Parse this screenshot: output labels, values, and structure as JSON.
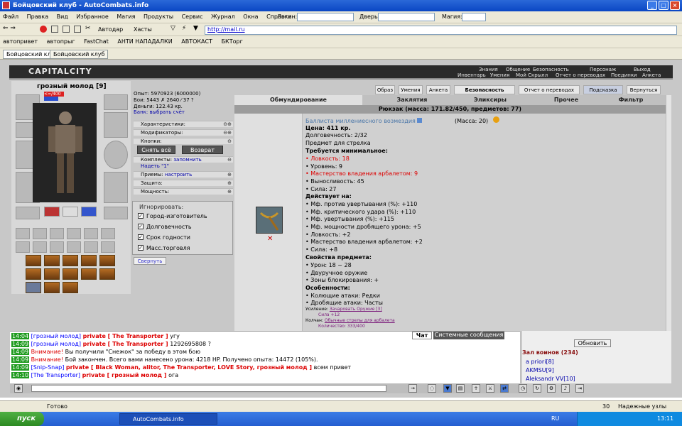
{
  "window": {
    "title": "Бойцовский клуб - AutoCombats.info",
    "buttons": [
      "_",
      "□",
      "×"
    ]
  },
  "menu": {
    "items": [
      "Файл",
      "Правка",
      "Вид",
      "Избранное",
      "Магия",
      "Продукты",
      "Сервис",
      "Журнал",
      "Окна",
      "Справка"
    ],
    "login_label": "Логин:",
    "door_label": "Дверь:",
    "magic_label": "Магия:"
  },
  "address": {
    "dropdown1": "Автодар",
    "dropdown2": "Хасты",
    "url": "http://mail.ru"
  },
  "links": [
    "автопривет",
    "автопрыг",
    "FastChat",
    "АНТИ НАПАДАЛКИ",
    "АВТОКАСТ",
    "БКТорг"
  ],
  "browser_tabs": [
    "Бойцовский клуб",
    "Бойцовский клуб"
  ],
  "game_header": {
    "logo": "CAPITALCITY",
    "top_links": [
      "Знания",
      "Общение",
      "Безопасность",
      "Персонаж",
      "Выход"
    ],
    "bottom_links": [
      "Инвентарь",
      "Умения",
      "Мой Скрылл",
      "Отчет о переводах",
      "Поединки",
      "Анкета"
    ]
  },
  "character": {
    "name": "грозный молод",
    "level": "[9]",
    "hp": "<=/400",
    "stats": {
      "exp": "Опыт: 5970923 (6000000)",
      "wins": "Бои: 5443 ✗ 2640 ⁄ 37 ?",
      "money": "Деньги: 122.43 кр.",
      "bank": "Банк: выбрать счёт"
    },
    "sections": [
      "Характеристики:",
      "Модификаторы:",
      "Кнопки:"
    ],
    "undress": "Снять всё",
    "back": "Возврат",
    "sets": [
      "Комплекты:",
      "Приемы:",
      "Защита:",
      "Мощность:"
    ],
    "sets_link": "запомнить",
    "equip": "Надеть \"1\"",
    "tricks_link": "настроить",
    "ignore_title": "Игнорировать:",
    "ignore": [
      "Город-изготовитель",
      "Долговечность",
      "Срок годности",
      "Масс.торговля"
    ],
    "collapse": "Свернуть"
  },
  "store": {
    "top_buttons": [
      "Образ",
      "Умения",
      "Анкета",
      "Безопасность",
      "Отчет о переводах",
      "Подсказка",
      "Вернуться"
    ],
    "tabs": [
      "Обмундирование",
      "Заклятия",
      "Эликсиры",
      "Прочее",
      "Фильтр"
    ],
    "backpack": "Рюкзак (масса: 171.82/450, предметов: 77)",
    "item": {
      "name": "Баллиста миллениесного возмездия",
      "mass": "(Масса: 20)",
      "price": "Цена: 411 кр.",
      "durability": "Долговечность: 2/32",
      "purpose": "Предмет для стрелка",
      "req_title": "Требуется минимальное:",
      "req": [
        "• Ловкость: 18",
        "• Уровень: 9",
        "• Мастерство владения арбалетом: 9",
        "• Выносливость: 45",
        "• Сила: 27"
      ],
      "acts_title": "Действует на:",
      "acts": [
        "• Мф. против увертывания (%): +110",
        "• Мф. критического удара (%): +110",
        "• Мф. увертывания (%): +115",
        "• Мф. мощности дробящего урона: +5",
        "• Ловкость: +2",
        "• Мастерство владения арбалетом: +2",
        "• Сила: +8"
      ],
      "props_title": "Свойства предмета:",
      "props": [
        "• Урон: 18 ~ 28",
        "• Двуручное оружие",
        "• Зоны блокирования: +"
      ],
      "features_title": "Особенности:",
      "features": [
        "• Колющие атаки: Редки",
        "• Дробящие атаки: Часты"
      ],
      "enhance": "Усиление:",
      "enhance_link": "Зачаровать Оружие [3]",
      "enhance_val": "Сила +12",
      "quiver": "Колчан:",
      "quiver_link": "Обычные стрелы для арбалета",
      "quiver_qty": "Количество: 333/400"
    }
  },
  "chat": {
    "tabs": [
      "Чат",
      "Системные сообщения"
    ],
    "lines": [
      {
        "time": "14:04",
        "nick": "[грозный молод]",
        "priv": "private [ The Transporter ]",
        "text": "угу"
      },
      {
        "time": "14:09",
        "nick": "[грозный молод]",
        "priv": "private [ The Transporter ]",
        "text": "1292695808 ?"
      },
      {
        "time": "14:09",
        "nick": "Внимание!",
        "priv": "",
        "text": "Вы получили \"Снежок\" за победу в этом бою"
      },
      {
        "time": "14:09",
        "nick": "Внимание!",
        "priv": "",
        "text": "Бой закончен. Всего вами нанесено урона: 4218 HP. Получено опыта: 14472 (105%)."
      },
      {
        "time": "14:09",
        "nick": "[Snip-Snap]",
        "priv": "private [ Black Woman, alitor, The Transporter, LOVE Story, грозный молод ]",
        "text": "всем привет"
      },
      {
        "time": "14:10",
        "nick": "[The Transporter]",
        "priv": "private [ грозный молод ]",
        "text": "ога"
      }
    ]
  },
  "users": {
    "refresh": "Обновить",
    "title": "Зал воинов (234)",
    "list": [
      "a priori[8]",
      "AKMSU[9]",
      "Aleksandr VV[10]"
    ]
  },
  "status": {
    "left": "Готово",
    "zoom": "30",
    "zone": "Надежные узлы"
  },
  "taskbar": {
    "start": "пуск",
    "task": "AutoCombats.info",
    "lang": "RU",
    "time": "13:11"
  }
}
